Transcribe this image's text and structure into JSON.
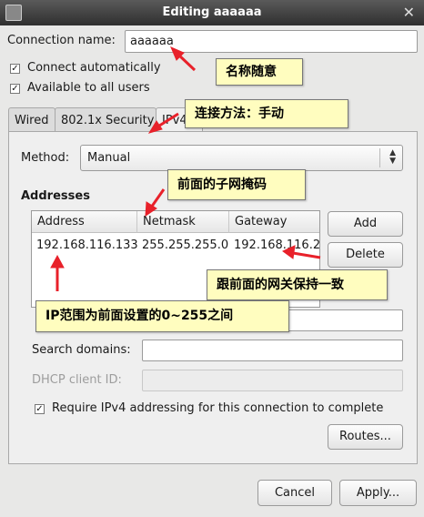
{
  "window": {
    "title": "Editing aaaaaa"
  },
  "form": {
    "connection_name_label": "Connection name:",
    "connection_name_value": "aaaaaa",
    "connect_automatically": {
      "label": "Connect automatically",
      "checked": true
    },
    "available_to_all_users": {
      "label": "Available to all users",
      "checked": true
    }
  },
  "tabs": [
    {
      "label": "Wired"
    },
    {
      "label": "802.1x Security"
    },
    {
      "label": "IPv4"
    }
  ],
  "ipv4": {
    "method_label": "Method:",
    "method_value": "Manual",
    "addresses_heading": "Addresses",
    "columns": [
      "Address",
      "Netmask",
      "Gateway"
    ],
    "rows": [
      {
        "address": "192.168.116.133",
        "netmask": "255.255.255.0",
        "gateway": "192.168.116.2"
      }
    ],
    "add_button": "Add",
    "delete_button": "Delete",
    "search_domains_label": "Search domains:",
    "dhcp_client_id_label": "DHCP client ID:",
    "require_ipv4": {
      "label": "Require IPv4 addressing for this connection to complete",
      "checked": true
    },
    "routes_button": "Routes..."
  },
  "dialog_buttons": {
    "cancel": "Cancel",
    "apply": "Apply..."
  },
  "annotations": {
    "name_note": "名称随意",
    "method_note": "连接方法：手动",
    "netmask_note": "前面的子网掩码",
    "gateway_note": "跟前面的网关保持一致",
    "ip_note": "IP范围为前面设置的0~255之间"
  },
  "colors": {
    "annotation_bg": "#fffdbf",
    "arrow_red": "#e8212a",
    "titlebar": "#3c3c3c"
  }
}
